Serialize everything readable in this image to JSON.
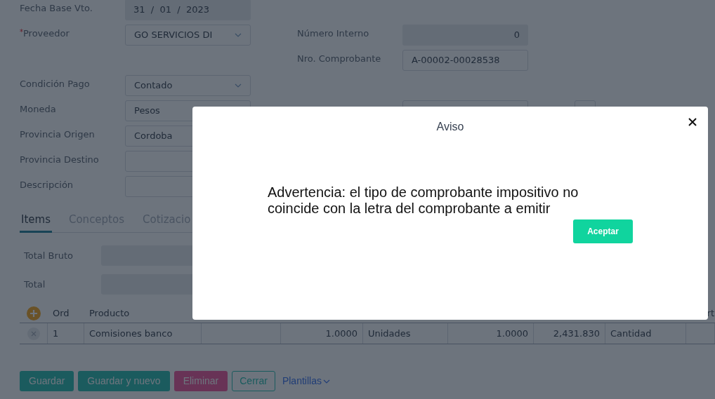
{
  "form_rows": [
    {
      "left": {
        "label": "Fecha Base Vto.",
        "value": "31  /  01  /  2023",
        "kind": "readonly"
      }
    },
    {
      "left": {
        "label": "Proveedor",
        "required_mark": "*",
        "value": "GO SERVICIOS DI",
        "kind": "select"
      },
      "right": {
        "label": "Número Interno",
        "value": "0",
        "kind": "readonly_number"
      }
    },
    {
      "right": {
        "label": "Nro. Comprobante",
        "value": "A-00002-00028538",
        "kind": "text"
      }
    },
    {
      "left": {
        "label": "Condición Pago",
        "value": "Contado",
        "kind": "select"
      }
    },
    {
      "left": {
        "label": "Moneda",
        "value": "Pesos",
        "kind": "text"
      },
      "right": {
        "kind": "text_with_button"
      }
    },
    {
      "left": {
        "label": "Provincia Origen",
        "value": "Cordoba",
        "kind": "text"
      }
    },
    {
      "left": {
        "label": "Provincia Destino",
        "kind": "text"
      }
    },
    {
      "left": {
        "label": "Descripción",
        "kind": "text"
      }
    }
  ],
  "tabs": [
    {
      "label": "Items",
      "selected": true
    },
    {
      "label": "Conceptos",
      "selected": false
    },
    {
      "label": "Cotizacio",
      "selected": false
    }
  ],
  "totals": [
    {
      "label": "Total Bruto"
    },
    {
      "label": "Total"
    }
  ],
  "table": {
    "columns": [
      "Ord",
      "Producto"
    ],
    "column_cut": "rt",
    "rows": [
      {
        "cells": [
          "1",
          "Comisiones banco",
          "",
          "1.0000",
          "Unidades",
          "1.0000",
          "2,431.830",
          "Cantidad",
          ""
        ]
      }
    ]
  },
  "buttons": [
    {
      "label": "Guardar",
      "kind": "primary"
    },
    {
      "label": "Guardar y nuevo",
      "kind": "primary"
    },
    {
      "label": "Eliminar",
      "kind": "danger"
    },
    {
      "label": "Cerrar",
      "kind": "outline"
    },
    {
      "label": "Plantillas",
      "kind": "dropdown"
    }
  ],
  "dialog": {
    "title": "Aviso",
    "message": "Advertencia: el tipo de comprobante impositivo no coincide con la letra del comprobante a emitir",
    "button": "Aceptar"
  }
}
